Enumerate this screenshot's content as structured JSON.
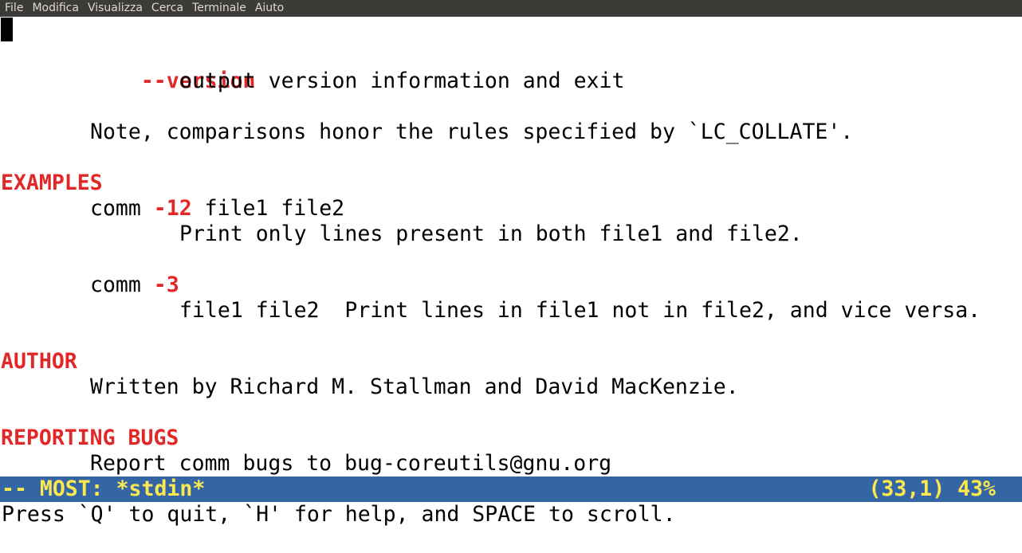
{
  "menu": {
    "items": [
      "File",
      "Modifica",
      "Visualizza",
      "Cerca",
      "Terminale",
      "Aiuto"
    ]
  },
  "content": {
    "version_flag": "--version",
    "version_desc": "output version information and exit",
    "note": "Note, comparisons honor the rules specified by `LC_COLLATE'.",
    "examples_heading": "EXAMPLES",
    "ex1_cmd": "comm ",
    "ex1_flag": "-12",
    "ex1_args": " file1 file2",
    "ex1_desc": "Print only lines present in both file1 and file2.",
    "ex2_cmd": "comm ",
    "ex2_flag": "-3",
    "ex2_desc": "file1 file2  Print lines in file1 not in file2, and vice versa.",
    "author_heading": "AUTHOR",
    "author_text": "Written by Richard M. Stallman and David MacKenzie.",
    "bugs_heading": "REPORTING BUGS",
    "bugs_text": "Report comm bugs to bug-coreutils@gnu.org"
  },
  "status": {
    "left": "-- MOST: *stdin*",
    "right": "(33,1) 43%"
  },
  "prompt": "Press `Q' to quit, `H' for help, and SPACE to scroll."
}
